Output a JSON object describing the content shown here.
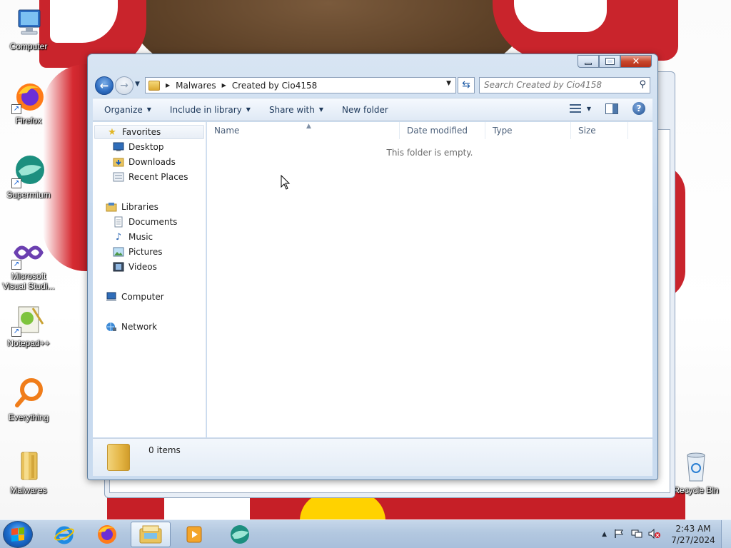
{
  "desktop": {
    "icons": [
      {
        "label": "Computer"
      },
      {
        "label": "Firefox"
      },
      {
        "label": "Supermium"
      },
      {
        "label": "Microsoft Visual Studi..."
      },
      {
        "label": "Notepad++"
      },
      {
        "label": "Everything"
      },
      {
        "label": "Malwares"
      },
      {
        "label": "Recycle Bin"
      }
    ]
  },
  "window": {
    "breadcrumb": [
      "Malwares",
      "Created by Cio4158"
    ],
    "search_placeholder": "Search Created by Cio4158",
    "commands": {
      "organize": "Organize",
      "include_in_library": "Include in library",
      "share_with": "Share with",
      "new_folder": "New folder"
    },
    "nav": {
      "favorites": "Favorites",
      "desktop": "Desktop",
      "downloads": "Downloads",
      "recent_places": "Recent Places",
      "libraries": "Libraries",
      "documents": "Documents",
      "music": "Music",
      "pictures": "Pictures",
      "videos": "Videos",
      "computer": "Computer",
      "network": "Network"
    },
    "columns": {
      "name": "Name",
      "date_modified": "Date modified",
      "type": "Type",
      "size": "Size"
    },
    "empty_message": "This folder is empty.",
    "item_count": "0 items"
  },
  "taskbar": {
    "time": "2:43 AM",
    "date": "7/27/2024"
  }
}
